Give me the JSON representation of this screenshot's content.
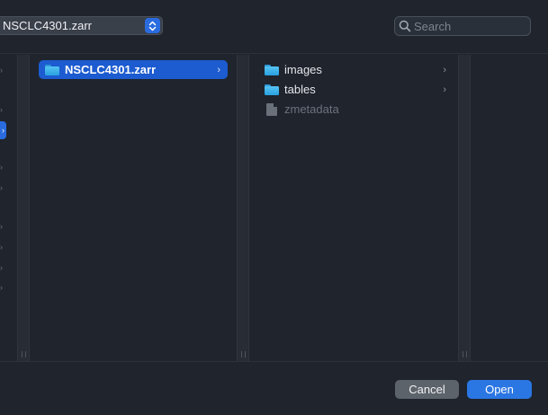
{
  "toolbar": {
    "location": "NSCLC4301.zarr",
    "stepper_icon": "up-down-chevron-icon",
    "search_placeholder": "Search",
    "search_value": ""
  },
  "browser": {
    "column1": {
      "items": [
        {
          "name": "NSCLC4301.zarr",
          "icon": "folder-icon",
          "selected": true,
          "has_children": true,
          "chevron": "›"
        }
      ]
    },
    "column2": {
      "items": [
        {
          "name": "images",
          "icon": "folder-icon",
          "selected": false,
          "has_children": true,
          "chevron": "›"
        },
        {
          "name": "tables",
          "icon": "folder-icon",
          "selected": false,
          "has_children": true,
          "chevron": "›"
        },
        {
          "name": "zmetadata",
          "icon": "document-icon",
          "selected": false,
          "has_children": false,
          "dimmed": true
        }
      ]
    }
  },
  "buttons": {
    "cancel": "Cancel",
    "open": "Open"
  },
  "colors": {
    "background": "#1f242d",
    "selection": "#1c5bd0",
    "accent": "#2a76e3",
    "folder": "#3ab3ee"
  }
}
